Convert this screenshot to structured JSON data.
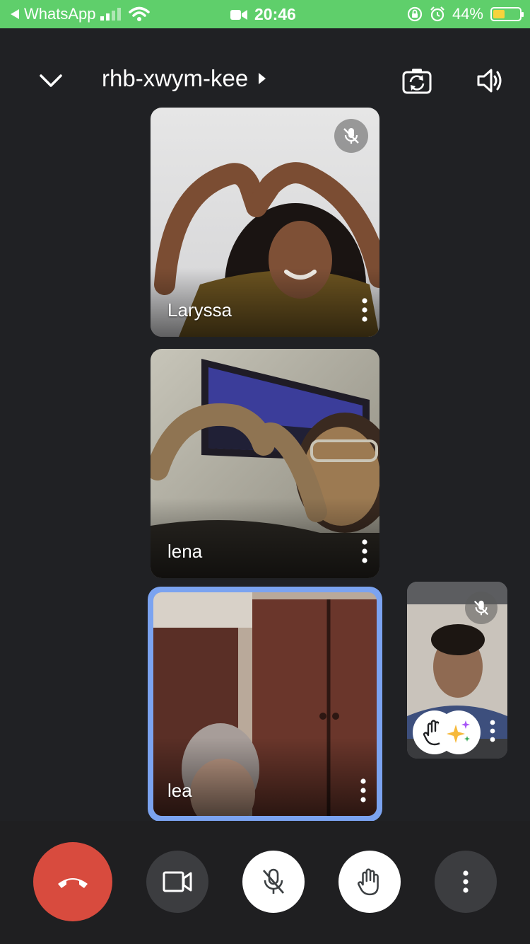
{
  "status_bar": {
    "back_app": "WhatsApp",
    "time": "20:46",
    "battery_percent": "44%",
    "battery_level": 0.44
  },
  "header": {
    "meeting_code": "rhb-xwym-kee"
  },
  "participants": [
    {
      "name": "Laryssa",
      "muted": true
    },
    {
      "name": "lena",
      "muted": false
    },
    {
      "name": "lea",
      "muted": false,
      "active_speaker": true
    }
  ],
  "self_view": {
    "muted": true,
    "hand_raised": true
  },
  "colors": {
    "status_bar": "#5fcf6b",
    "background": "#202124",
    "end_call": "#d84b3e",
    "active_border": "#7ba3f0"
  },
  "icons": {
    "collapse": "chevron-down-icon",
    "switch_camera": "switch-camera-icon",
    "speaker": "speaker-icon",
    "end_call": "phone-hangup-icon",
    "camera": "video-camera-icon",
    "mic": "mic-off-icon",
    "raise_hand": "hand-icon",
    "more": "more-vert-icon"
  }
}
